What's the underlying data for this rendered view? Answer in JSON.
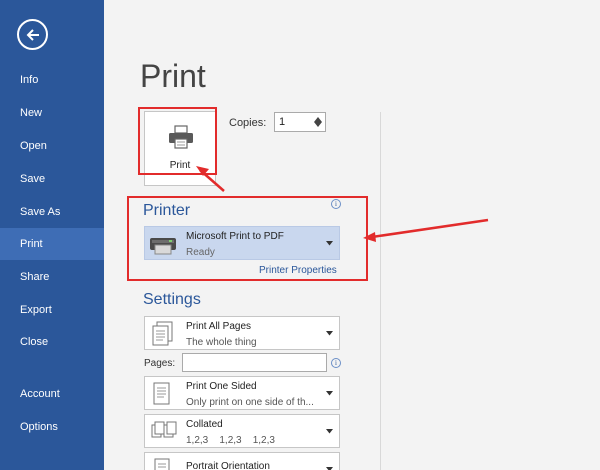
{
  "sidebar": {
    "items": [
      {
        "label": "Info"
      },
      {
        "label": "New"
      },
      {
        "label": "Open"
      },
      {
        "label": "Save"
      },
      {
        "label": "Save As"
      },
      {
        "label": "Print",
        "active": true
      },
      {
        "label": "Share"
      },
      {
        "label": "Export"
      },
      {
        "label": "Close"
      },
      {
        "label": "Account"
      },
      {
        "label": "Options"
      }
    ]
  },
  "main": {
    "title": "Print",
    "print_button_label": "Print",
    "copies_label": "Copies:",
    "copies_value": "1"
  },
  "printer": {
    "heading": "Printer",
    "name": "Microsoft Print to PDF",
    "status": "Ready",
    "properties_link": "Printer Properties"
  },
  "settings": {
    "heading": "Settings",
    "pages_label": "Pages:",
    "pages_value": "",
    "items": [
      {
        "title": "Print All Pages",
        "subtitle": "The whole thing"
      },
      {
        "title": "Print One Sided",
        "subtitle": "Only print on one side of th..."
      },
      {
        "title": "Collated",
        "subtitle": "1,2,3    1,2,3    1,2,3"
      },
      {
        "title": "Portrait Orientation",
        "subtitle": ""
      }
    ]
  },
  "colors": {
    "sidebar": "#2b579a",
    "sidebar_active": "#3e6db5",
    "accent": "#2b579a",
    "annotation": "#e22b2b"
  }
}
